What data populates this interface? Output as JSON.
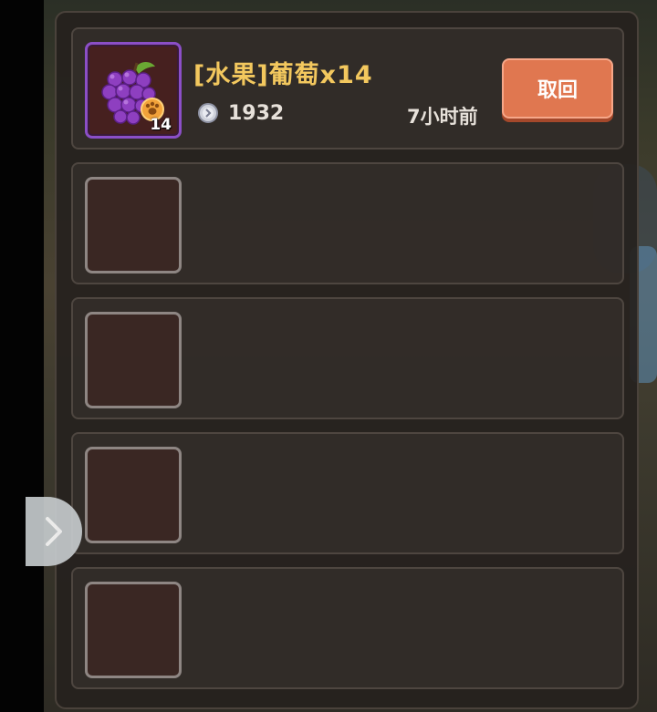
{
  "listing": {
    "item_name": "[水果]葡萄x14",
    "icon": "grapes-icon",
    "quantity_badge": "14",
    "price": "1932",
    "price_icon": "coin-icon",
    "time_ago": "7小时前",
    "retrieve_label": "取回"
  },
  "empty_slots": 4,
  "colors": {
    "accent_button": "#e07750",
    "item_name": "#f3c85e",
    "rarity_border": "#8b4fc7"
  },
  "side_tab": {
    "icon": "chevron-right-icon"
  }
}
